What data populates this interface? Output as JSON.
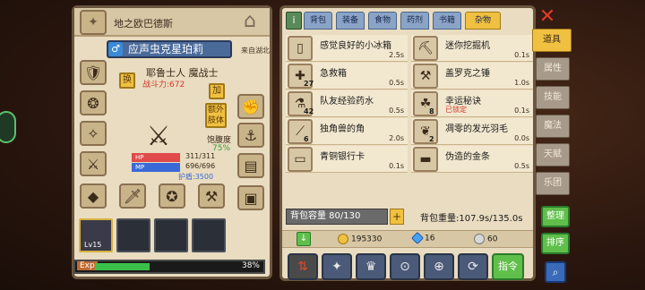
{
  "side_pill": {
    "label": ""
  },
  "character": {
    "title": "地之欧巴德斯",
    "name": "应声虫克星珀莉",
    "origin": "来自湖北",
    "class": "耶鲁士人 魔战士",
    "power": "战斗力:672",
    "swap_label": "换",
    "add_label": "加",
    "extra_body_label": "额外肢体",
    "hunger_label": "饱腹度",
    "hunger_value": "75%",
    "hp_label": "HP",
    "hp_value": "311/311",
    "mp_label": "MP",
    "mp_value": "696/696",
    "shield_value": "护盾:3500",
    "skill_level": "Lv15",
    "exp_label": "Exp",
    "exp_percent": "38%",
    "exp_fraction": 0.38
  },
  "inventory": {
    "tabs": [
      {
        "label": "背包"
      },
      {
        "label": "装备"
      },
      {
        "label": "食物"
      },
      {
        "label": "药剂"
      },
      {
        "label": "书籍"
      },
      {
        "label": "杂物"
      }
    ],
    "active_tab": "杂物",
    "items": [
      {
        "name": "感觉良好的小冰箱",
        "time": "2.5s",
        "count": "",
        "locked": "",
        "icon": "fridge-icon"
      },
      {
        "name": "迷你挖掘机",
        "time": "0.1s",
        "count": "",
        "locked": "",
        "icon": "excavator-icon"
      },
      {
        "name": "急救箱",
        "time": "0.5s",
        "count": "27",
        "locked": "",
        "icon": "firstaid-icon"
      },
      {
        "name": "盖罗克之锤",
        "time": "1.0s",
        "count": "",
        "locked": "",
        "icon": "hammer-icon"
      },
      {
        "name": "队友经验药水",
        "time": "0.5s",
        "count": "42",
        "locked": "",
        "icon": "potion-icon"
      },
      {
        "name": "幸运秘诀",
        "time": "0.1s",
        "count": "8",
        "locked": "已锁定",
        "icon": "clover-icon"
      },
      {
        "name": "独角兽的角",
        "time": "2.0s",
        "count": "6",
        "locked": "",
        "icon": "horn-icon"
      },
      {
        "name": "凋零的发光羽毛",
        "time": "0.0s",
        "count": "2",
        "locked": "",
        "icon": "feather-icon"
      },
      {
        "name": "青铜银行卡",
        "time": "0.1s",
        "count": "",
        "locked": "",
        "icon": "card-icon"
      },
      {
        "name": "伪造的金条",
        "time": "0.5s",
        "count": "",
        "locked": "",
        "icon": "goldbar-icon"
      }
    ],
    "capacity_label": "背包容量 80/130",
    "weight_label": "背包重量:107.9s/135.0s",
    "gold": "195330",
    "gems": "16",
    "silver": "60",
    "command_label": "指令"
  },
  "side_menu": {
    "tabs": [
      {
        "label": "道具"
      },
      {
        "label": "属性"
      },
      {
        "label": "技能"
      },
      {
        "label": "魔法"
      },
      {
        "label": "天赋"
      },
      {
        "label": "乐团"
      }
    ],
    "organize_label": "整理",
    "sort_label": "排序"
  },
  "colors": {
    "panel_bg": "#e9dcc0",
    "tab_active": "#f0c040",
    "hp_bar": "#e04a4a",
    "mp_bar": "#3a6ad8",
    "exp_bar": "#3ac04a",
    "green_button": "#5fbf4a"
  }
}
